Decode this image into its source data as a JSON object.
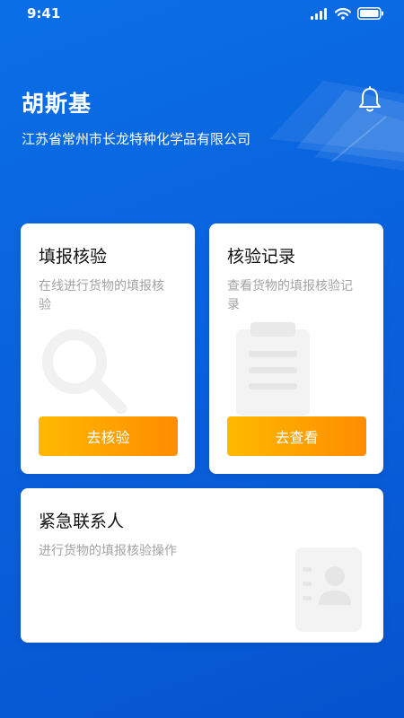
{
  "status_bar": {
    "time": "9:41"
  },
  "header": {
    "user_name": "胡斯基",
    "company": "江苏省常州市长龙特种化学品有限公司"
  },
  "cards": {
    "verify": {
      "title": "填报核验",
      "desc": "在线进行货物的填报核验",
      "button": "去核验"
    },
    "records": {
      "title": "核验记录",
      "desc": "查看货物的填报核验记录",
      "button": "去查看"
    },
    "contacts": {
      "title": "紧急联系人",
      "desc": "进行货物的填报核验操作"
    }
  },
  "colors": {
    "primary": "#0a67e2",
    "button_start": "#ffb900",
    "button_end": "#ff8c00"
  },
  "icons": [
    "signal-icon",
    "wifi-icon",
    "battery-icon",
    "bell-icon",
    "search-icon",
    "clipboard-icon",
    "contact-card-icon"
  ]
}
